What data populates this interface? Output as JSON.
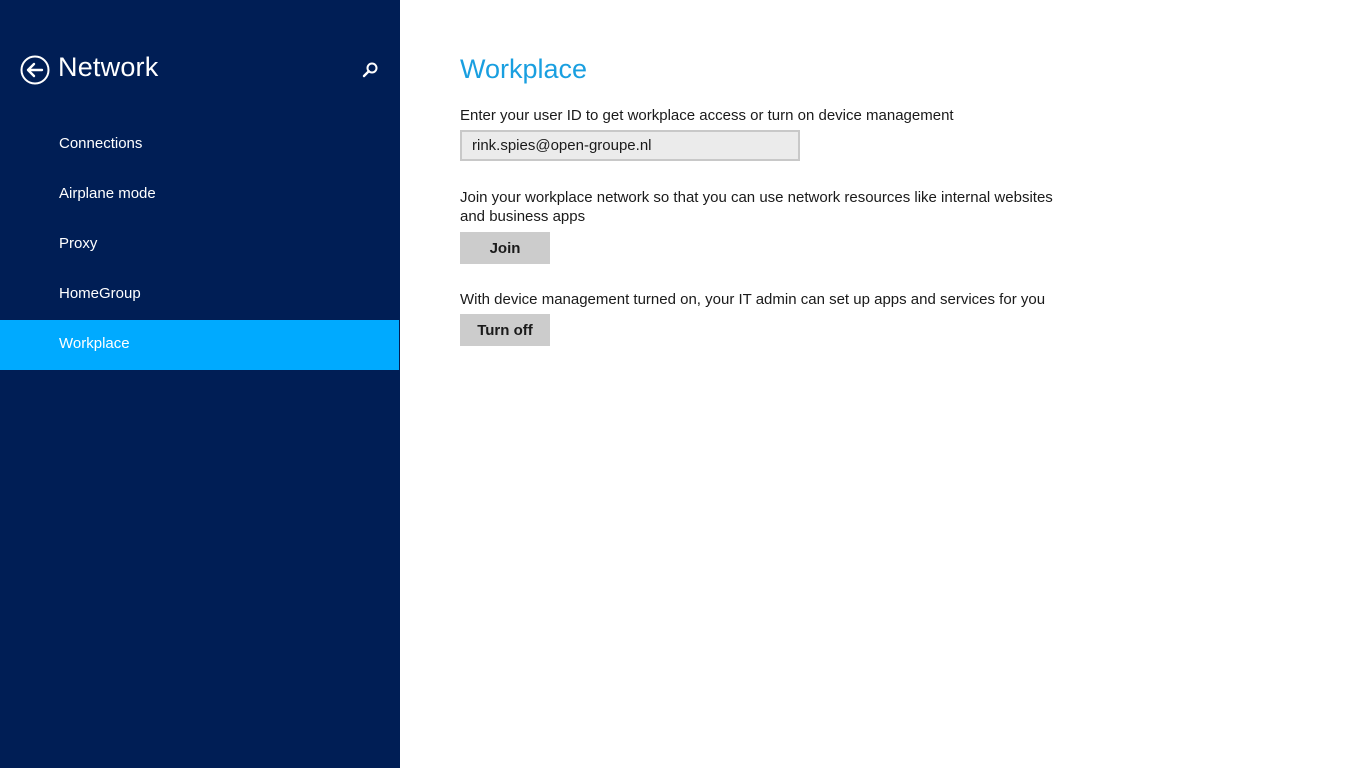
{
  "sidebar": {
    "title": "Network",
    "items": [
      {
        "label": "Connections"
      },
      {
        "label": "Airplane mode"
      },
      {
        "label": "Proxy"
      },
      {
        "label": "HomeGroup"
      },
      {
        "label": "Workplace"
      }
    ],
    "active_index": 4
  },
  "main": {
    "title": "Workplace",
    "user_id_prompt": "Enter your user ID to get workplace access or turn on device management",
    "user_id_value": "rink.spies@open-groupe.nl",
    "join_description": "Join your workplace network so that you can use network resources like internal websites and business apps",
    "join_label": "Join",
    "device_mgmt_description": "With device management turned on, your IT admin can set up apps and services for you",
    "turn_off_label": "Turn off"
  },
  "icons": {
    "back": "back-arrow-icon",
    "search": "search-icon"
  },
  "colors": {
    "sidebar_bg": "#001e55",
    "active_item": "#00aaff",
    "title_accent": "#199fe0",
    "button_bg": "#cccccc"
  }
}
